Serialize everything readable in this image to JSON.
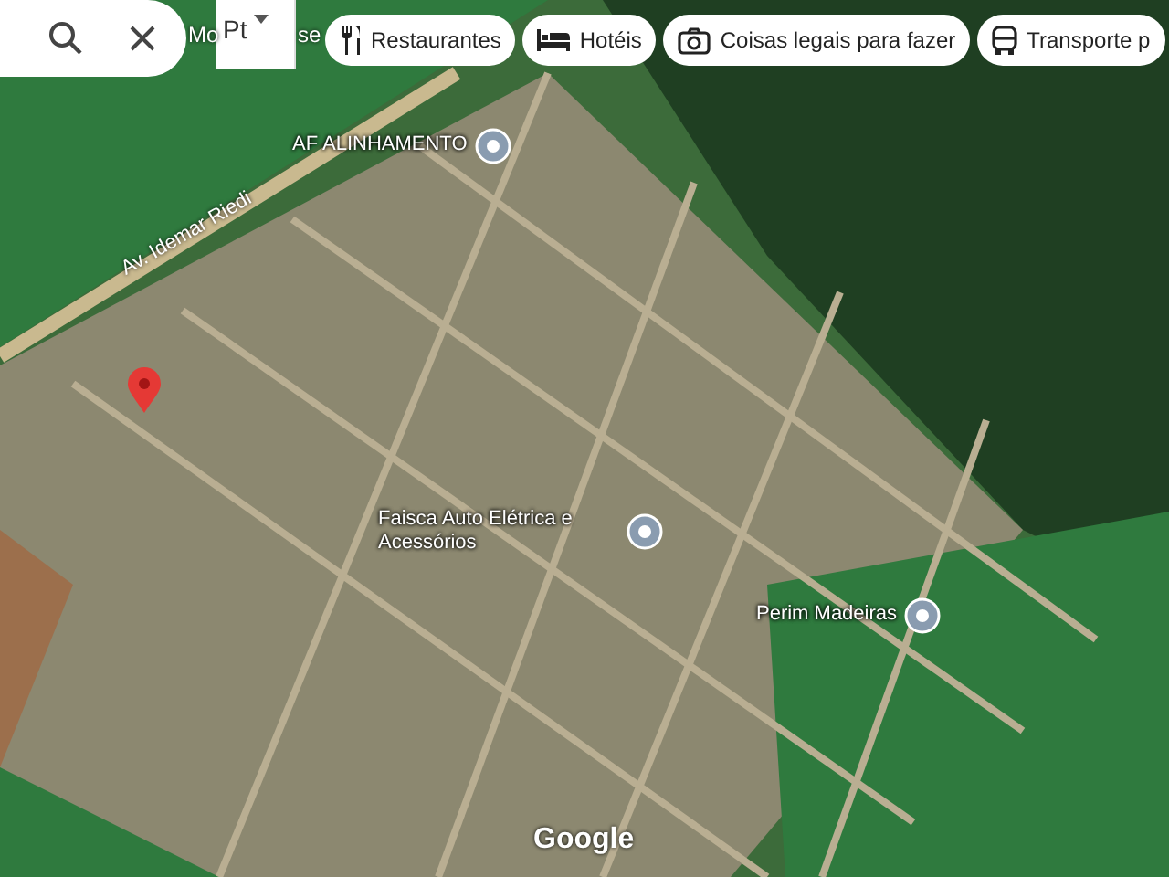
{
  "search_bar": {
    "fragment": "Pt"
  },
  "chips": [
    {
      "label": "Restaurantes"
    },
    {
      "label": "Hotéis"
    },
    {
      "label": "Coisas legais para fazer"
    },
    {
      "label": "Transporte p"
    }
  ],
  "map": {
    "fragments": [
      "Mo",
      "se"
    ],
    "street": "Av. Idemar Riedi",
    "places": [
      {
        "name": "AF ALINHAMENTO"
      },
      {
        "name": "Faisca Auto Elétrica e Acessórios"
      },
      {
        "name": "Perim Madeiras"
      }
    ],
    "attribution": "Google"
  }
}
